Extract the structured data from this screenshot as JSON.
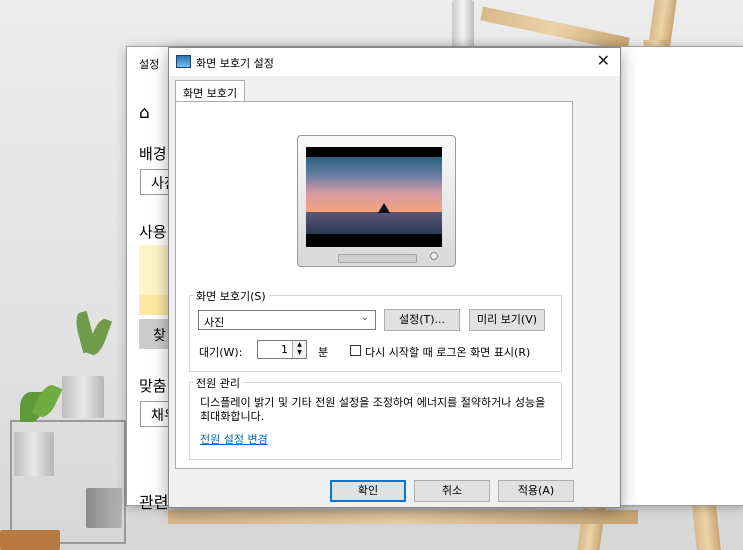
{
  "settings_window": {
    "title": "설정",
    "close_icon": "close-icon",
    "home_icon": "home-icon",
    "background_label": "배경",
    "background_value": "사진",
    "usage_label": "사용",
    "browse_button": "찾",
    "fit_label": "맞춤",
    "fit_value": "채우",
    "related_label": "관련"
  },
  "dialog": {
    "title": "화면 보호기 설정",
    "tab_label": "화면 보호기",
    "screensaver_group_label": "화면 보호기(S)",
    "screensaver_selected": "사진",
    "settings_button": "설정(T)...",
    "preview_button": "미리 보기(V)",
    "wait_label": "대기(W):",
    "wait_value": "1",
    "wait_unit": "분",
    "resume_checkbox_label": "다시 시작할 때 로그온 화면 표시(R)",
    "resume_checked": false,
    "power_group_label": "전원 관리",
    "power_description": "디스플레이 밝기 및 기타 전원 설정을 조정하여 에너지를 절약하거나 성능을 최대화합니다.",
    "power_link": "전원 설정 변경",
    "ok_button": "확인",
    "cancel_button": "취소",
    "apply_button": "적용(A)"
  },
  "colors": {
    "accent": "#0078d7",
    "link": "#0066cc"
  }
}
